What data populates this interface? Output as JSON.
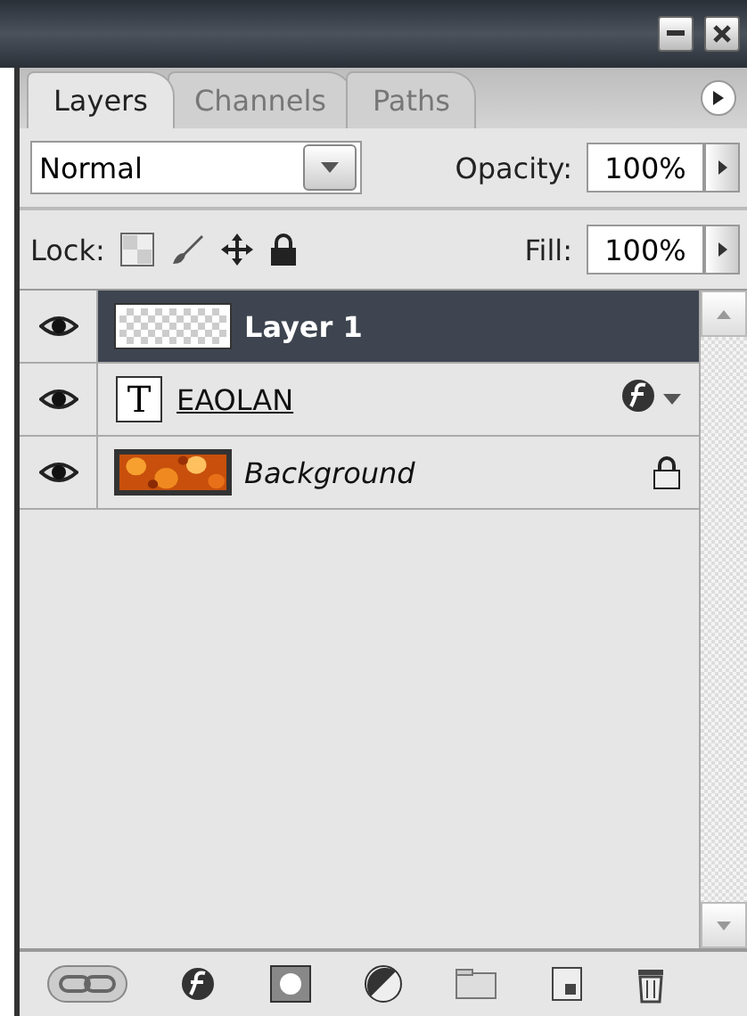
{
  "tabs": [
    {
      "label": "Layers",
      "selected": true
    },
    {
      "label": "Channels",
      "selected": false
    },
    {
      "label": "Paths",
      "selected": false
    }
  ],
  "blend": {
    "value": "Normal",
    "opacity_label": "Opacity:",
    "opacity": "100%"
  },
  "lock": {
    "label": "Lock:",
    "fill_label": "Fill:",
    "fill": "100%"
  },
  "layers": [
    {
      "name": "Layer 1",
      "kind": "pixel",
      "visible": true,
      "selected": true,
      "effects": false,
      "locked": false
    },
    {
      "name": "EAOLAN",
      "kind": "text",
      "glyph": "T",
      "visible": true,
      "selected": false,
      "effects": true,
      "locked": false
    },
    {
      "name": "Background",
      "kind": "background",
      "visible": true,
      "selected": false,
      "effects": false,
      "locked": true
    }
  ]
}
